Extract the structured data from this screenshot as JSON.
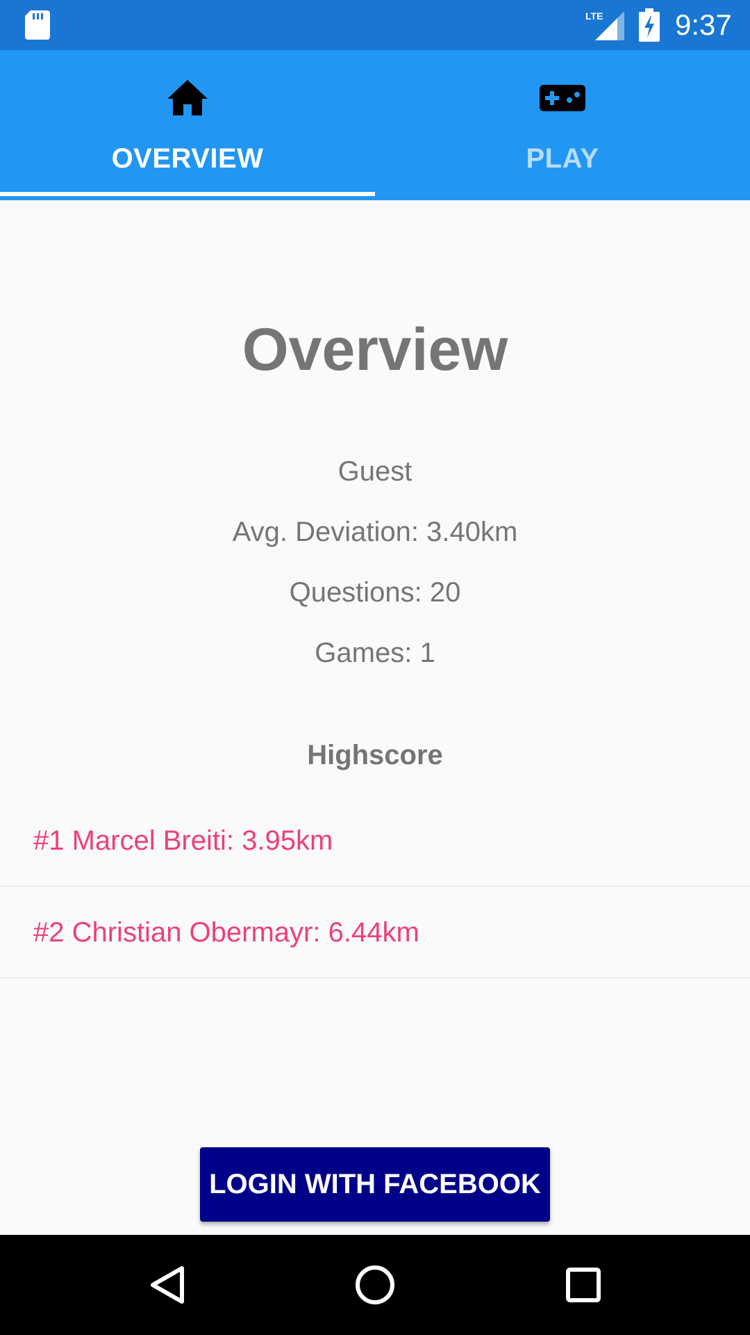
{
  "status_bar": {
    "time": "9:37",
    "network": "LTE",
    "icons": [
      "sd-card-icon",
      "lte-signal-icon",
      "battery-charging-icon"
    ]
  },
  "tabs": [
    {
      "label": "OVERVIEW",
      "icon": "home-icon",
      "selected": true
    },
    {
      "label": "PLAY",
      "icon": "gamepad-icon",
      "selected": false
    }
  ],
  "overview": {
    "title": "Overview",
    "user": "Guest",
    "avg_deviation": "Avg. Deviation: 3.40km",
    "questions": "Questions: 20",
    "games": "Games: 1"
  },
  "highscore": {
    "heading": "Highscore",
    "entries": [
      "#1 Marcel Breiti: 3.95km",
      "#2 Christian Obermayr: 6.44km"
    ]
  },
  "login_button": {
    "label": "LOGIN WITH FACEBOOK"
  },
  "nav_bar": {
    "buttons": [
      "back-icon",
      "home-circle-icon",
      "recents-icon"
    ]
  },
  "colors": {
    "status_bar": "#1976d2",
    "tab_bar": "#2196f3",
    "accent": "#ec407a",
    "facebook_button": "#000088",
    "text_secondary": "#757575"
  }
}
